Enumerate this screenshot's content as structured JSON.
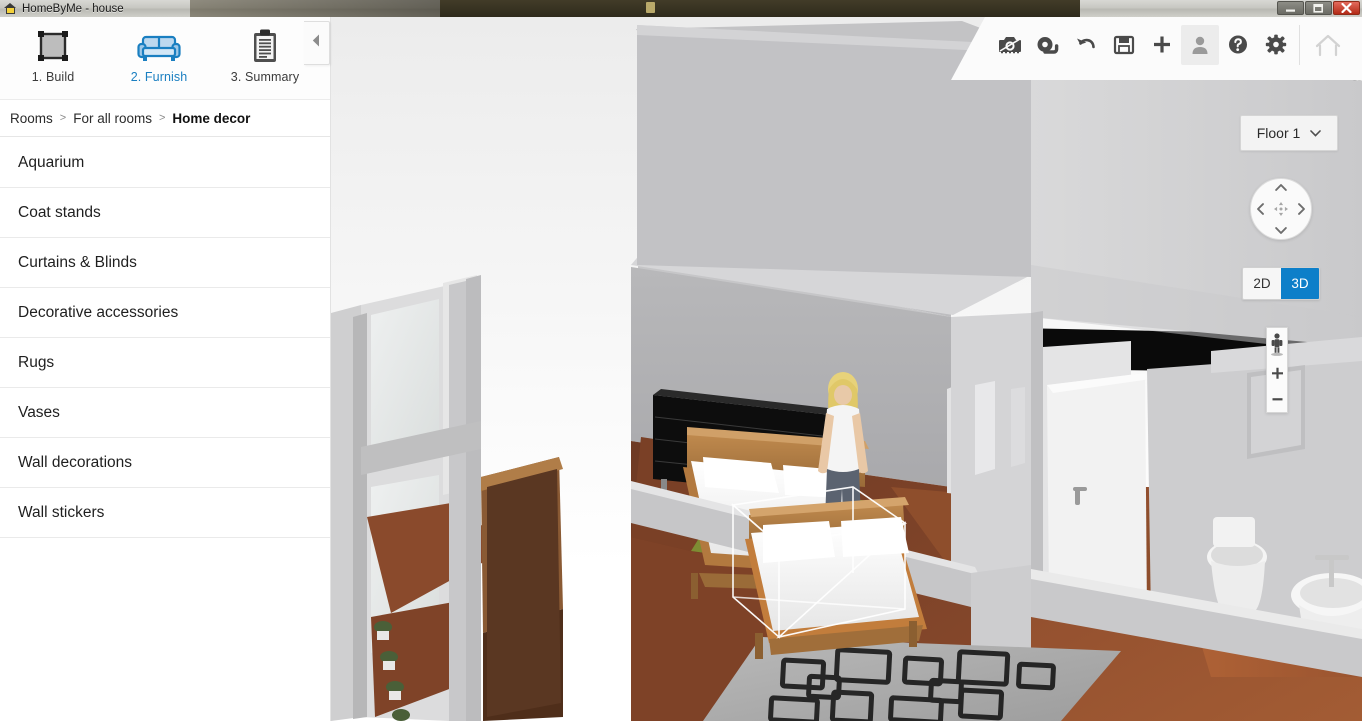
{
  "window": {
    "title": "HomeByMe - house",
    "app_icon": "house-icon",
    "controls": {
      "minimize": "minimize-button",
      "restore": "restore-button",
      "close": "close-button"
    }
  },
  "steps": [
    {
      "label": "1. Build",
      "icon": "floorplan-square-icon",
      "active": false
    },
    {
      "label": "2. Furnish",
      "icon": "sofa-icon",
      "active": true
    },
    {
      "label": "3. Summary",
      "icon": "clipboard-icon",
      "active": false
    }
  ],
  "breadcrumb": {
    "separator": ">",
    "items": [
      {
        "label": "Rooms",
        "current": false
      },
      {
        "label": "For all rooms",
        "current": false
      },
      {
        "label": "Home decor",
        "current": true
      }
    ]
  },
  "categories": [
    {
      "label": "Aquarium"
    },
    {
      "label": "Coat stands"
    },
    {
      "label": "Curtains & Blinds"
    },
    {
      "label": "Decorative accessories"
    },
    {
      "label": "Rugs"
    },
    {
      "label": "Vases"
    },
    {
      "label": "Wall decorations"
    },
    {
      "label": "Wall stickers"
    }
  ],
  "panel": {
    "collapse_icon": "chevron-left-icon"
  },
  "toolbar": {
    "items": [
      {
        "icon": "screenshot-camera-icon"
      },
      {
        "icon": "measure-tape-icon"
      },
      {
        "icon": "undo-icon"
      },
      {
        "icon": "save-floppy-icon"
      },
      {
        "icon": "add-plus-icon"
      },
      {
        "icon": "user-avatar-icon"
      },
      {
        "icon": "help-question-icon"
      },
      {
        "icon": "settings-gear-icon"
      }
    ],
    "home": {
      "icon": "home-outline-icon"
    }
  },
  "floor_select": {
    "label": "Floor 1",
    "caret_icon": "chevron-down-icon"
  },
  "nav_pad": {
    "up_icon": "chevron-up-icon",
    "down_icon": "chevron-down-icon",
    "left_icon": "chevron-left-icon",
    "right_icon": "chevron-right-icon",
    "center_icon": "move-crosshair-icon"
  },
  "view_mode": {
    "options": [
      {
        "label": "2D",
        "active": false
      },
      {
        "label": "3D",
        "active": true
      }
    ]
  },
  "zoom_control": {
    "person_icon": "person-walkthrough-icon",
    "zoom_in_label": "+",
    "zoom_out_label": "–"
  },
  "colors": {
    "accent_blue": "#1a7fc1",
    "active_toggle_blue": "#0d7fc9",
    "panel_bg": "#ffffff",
    "viewport_top": "#ececec",
    "close_red": "#b32a16"
  },
  "scene": {
    "description": "3D isometric view of a two-bedroom apartment floor plan",
    "selected_object": "bed-with-bounding-box"
  }
}
